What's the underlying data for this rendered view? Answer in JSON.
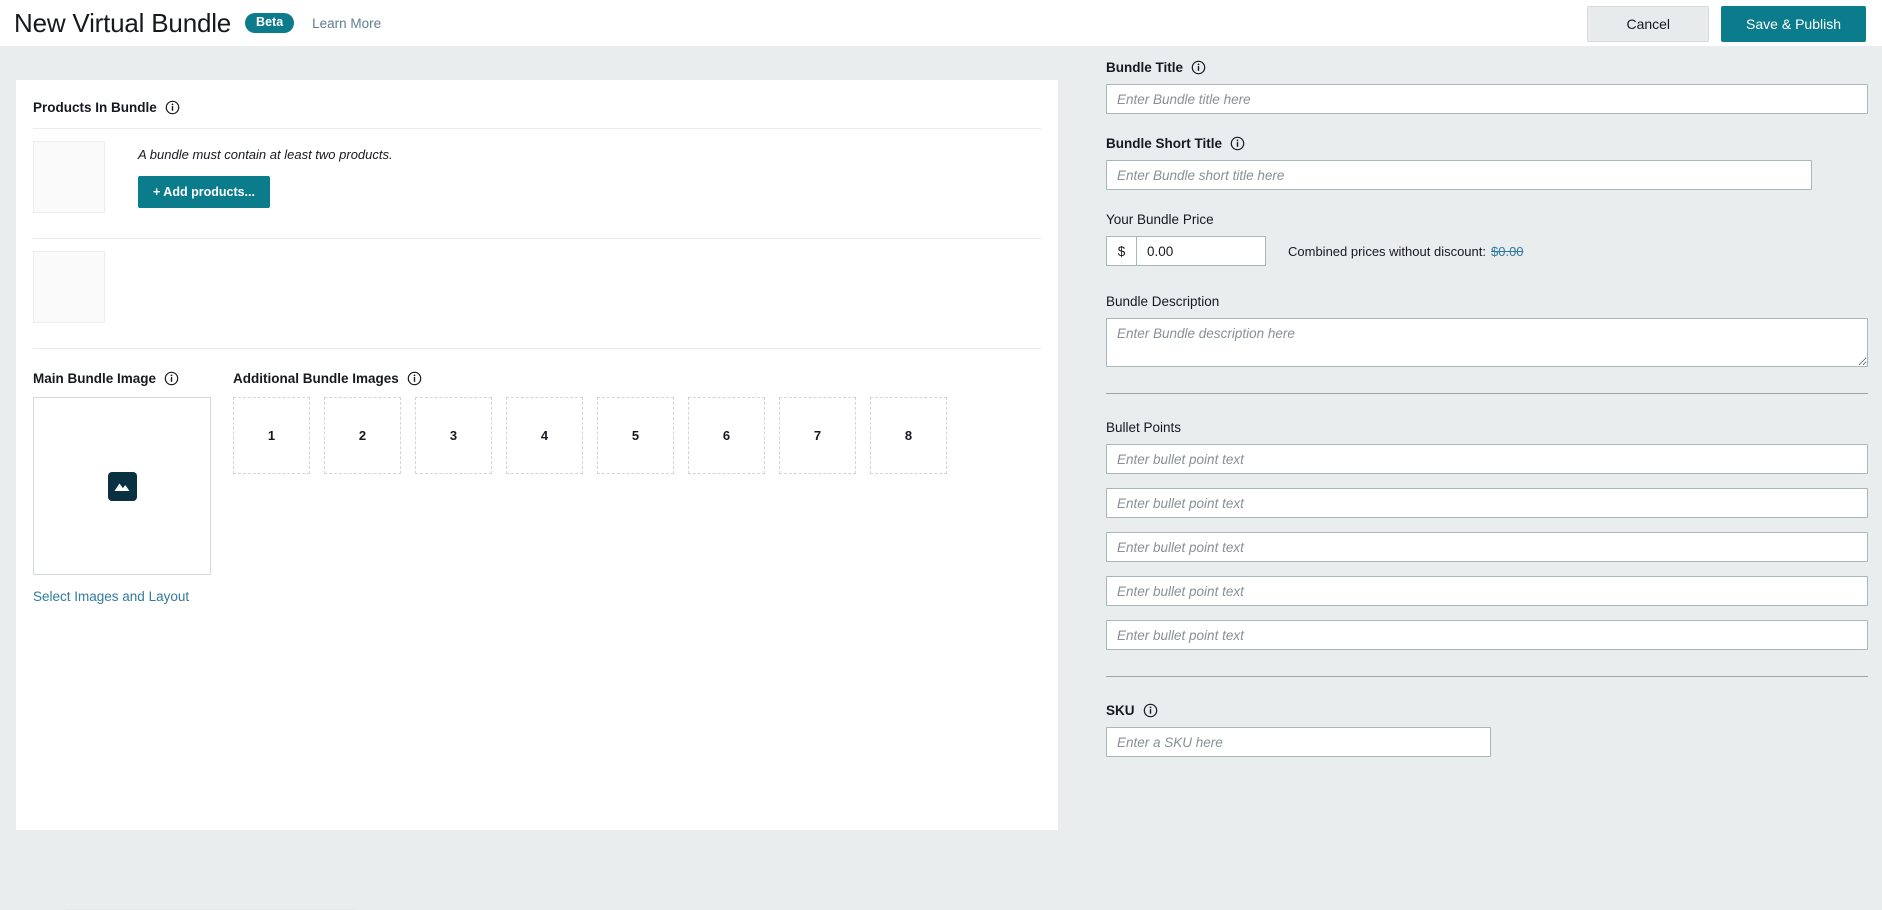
{
  "header": {
    "title": "New Virtual Bundle",
    "badge": "Beta",
    "learn_more": "Learn More",
    "cancel_label": "Cancel",
    "save_label": "Save & Publish"
  },
  "theme": {
    "accent": "#0b7c8c",
    "link": "#2f7a9e",
    "page_bg": "#eaedee",
    "card_bg": "#ffffff",
    "input_border": "#aab7b8"
  },
  "left": {
    "products_section": {
      "title": "Products In Bundle",
      "info_icon": "info-circle-icon",
      "hint": "A bundle must contain at least two products.",
      "add_button": "+ Add products...",
      "slots": 2
    },
    "main_image": {
      "title": "Main Bundle Image",
      "info_icon": "info-circle-icon",
      "placeholder_icon": "image-icon",
      "select_link": "Select Images and Layout"
    },
    "additional_images": {
      "title": "Additional Bundle Images",
      "info_icon": "info-circle-icon",
      "slots": [
        "1",
        "2",
        "3",
        "4",
        "5",
        "6",
        "7",
        "8"
      ]
    }
  },
  "right": {
    "bundle_title": {
      "label": "Bundle Title",
      "info_icon": "info-circle-icon",
      "value": "",
      "placeholder": "Enter Bundle title here"
    },
    "bundle_short_title": {
      "label": "Bundle Short Title",
      "info_icon": "info-circle-icon",
      "value": "",
      "placeholder": "Enter Bundle short title here"
    },
    "price": {
      "label": "Your Bundle Price",
      "currency_symbol": "$",
      "value": "0.00",
      "combined_label": "Combined prices without discount:",
      "combined_value": "$0.00"
    },
    "description": {
      "label": "Bundle Description",
      "value": "",
      "placeholder": "Enter Bundle description here"
    },
    "bullet_points": {
      "label": "Bullet Points",
      "items": [
        {
          "value": "",
          "placeholder": "Enter bullet point text"
        },
        {
          "value": "",
          "placeholder": "Enter bullet point text"
        },
        {
          "value": "",
          "placeholder": "Enter bullet point text"
        },
        {
          "value": "",
          "placeholder": "Enter bullet point text"
        },
        {
          "value": "",
          "placeholder": "Enter bullet point text"
        }
      ]
    },
    "sku": {
      "label": "SKU",
      "info_icon": "info-circle-icon",
      "value": "",
      "placeholder": "Enter a SKU here"
    }
  }
}
